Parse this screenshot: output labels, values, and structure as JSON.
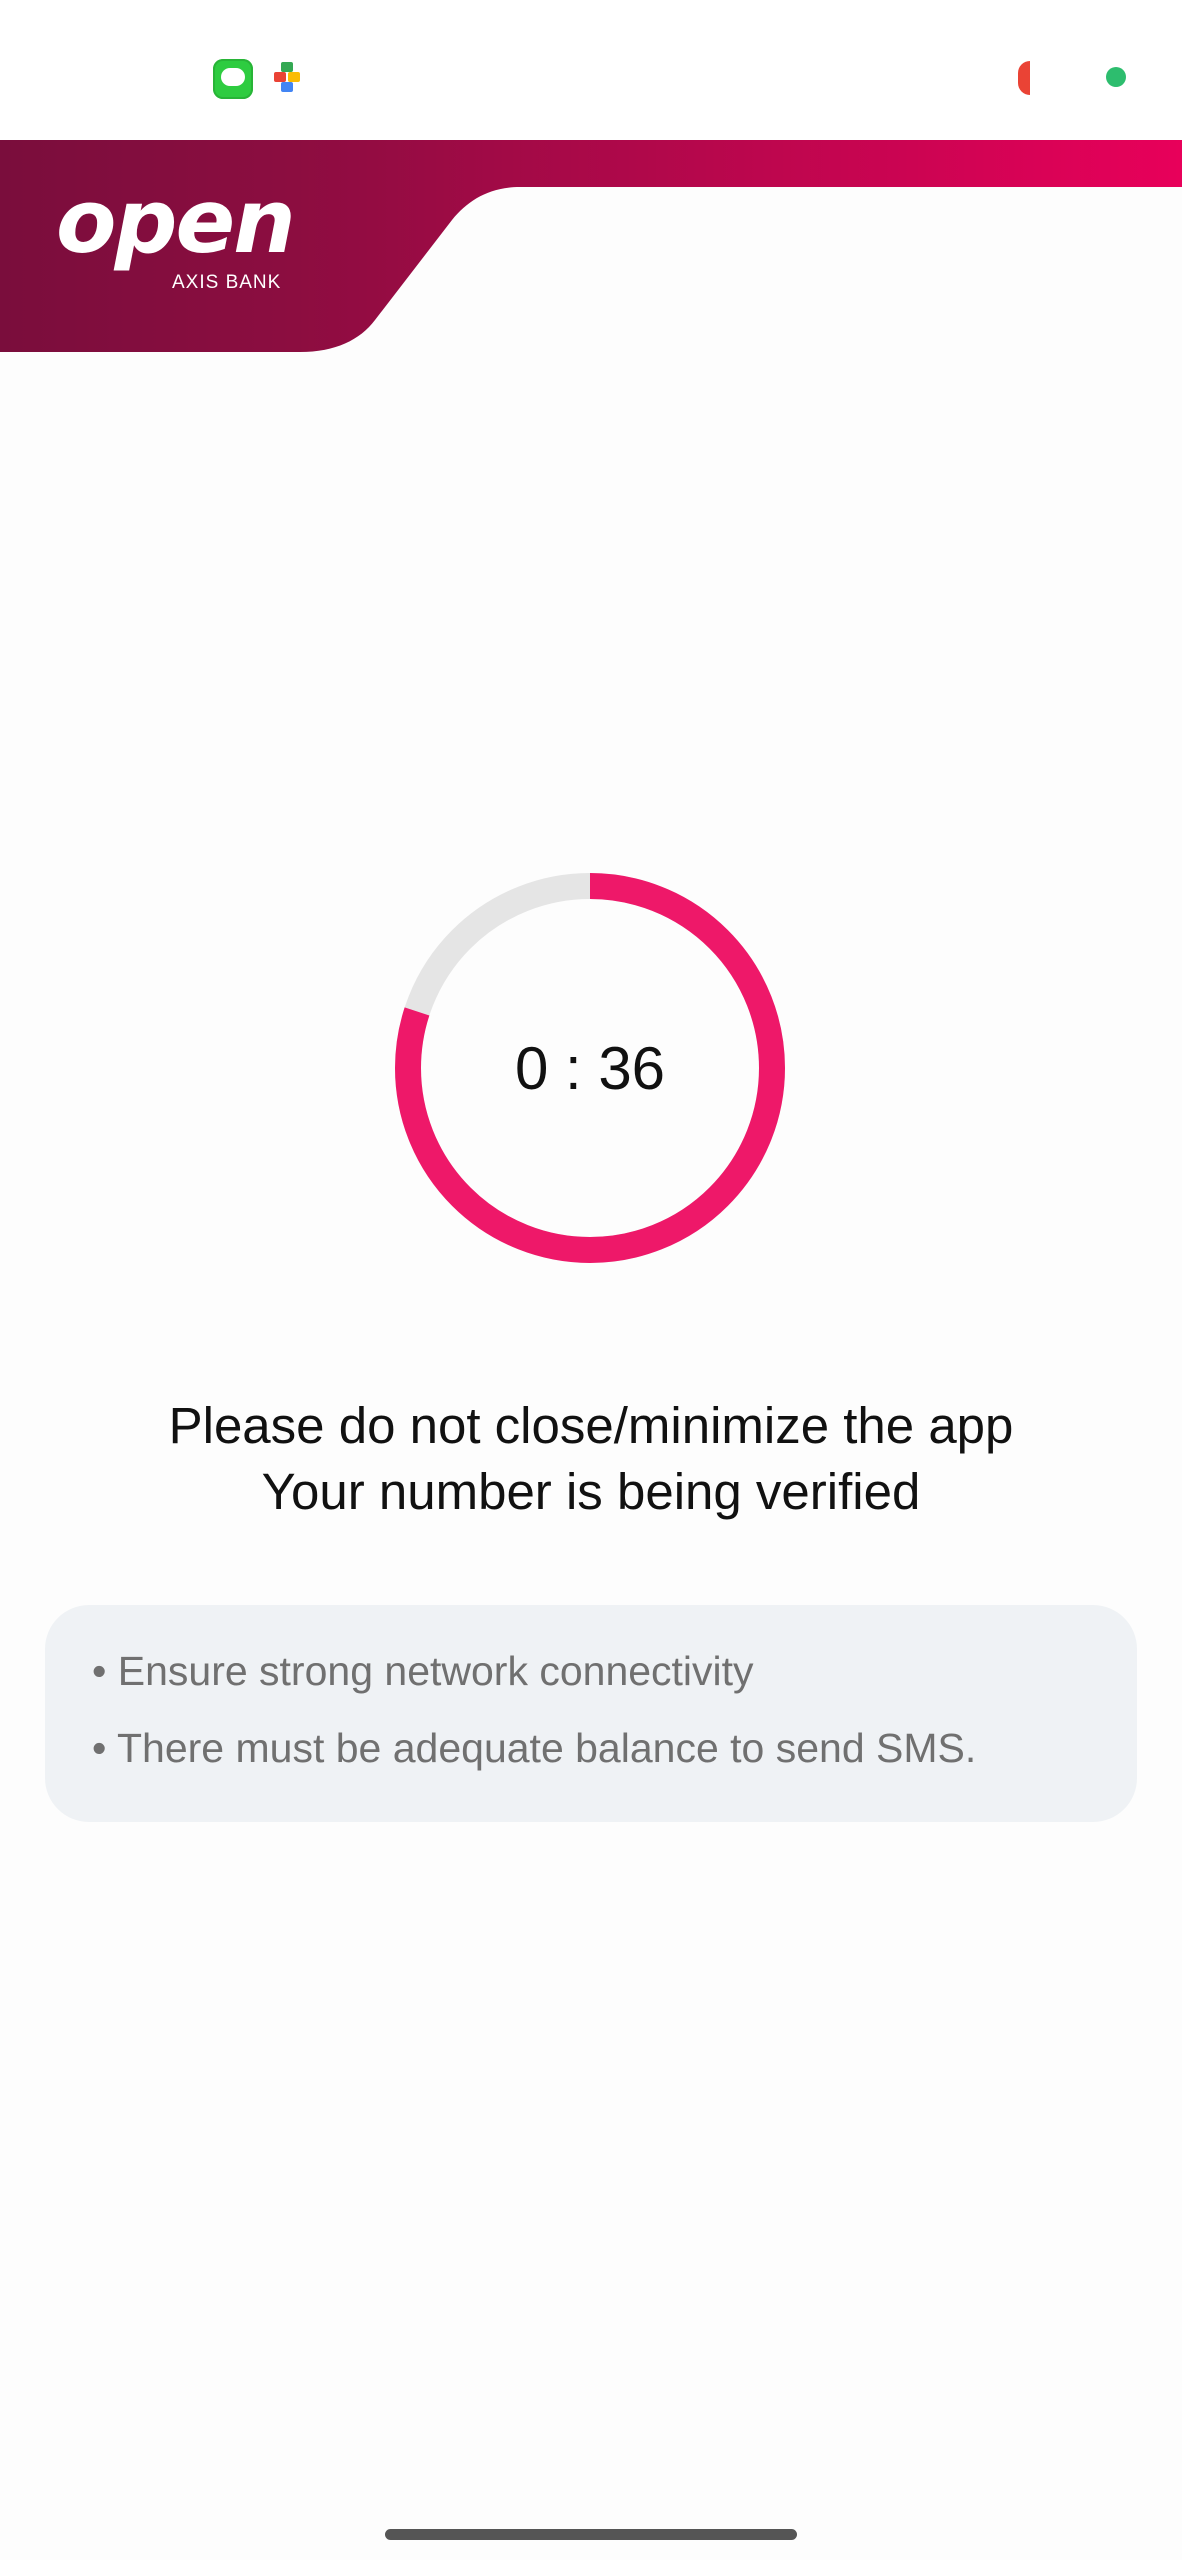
{
  "status_bar": {
    "icons": [
      "messages-icon",
      "puzzle-icon",
      "record-indicator",
      "green-dot"
    ]
  },
  "header": {
    "logo_word": "open",
    "logo_subtitle": "AXIS BANK",
    "colors": {
      "gradient_start": "#7a0d3c",
      "gradient_end": "#e8005a"
    }
  },
  "timer": {
    "display": "0 : 36",
    "progress_fraction": 0.8,
    "colors": {
      "progress": "#ee1869",
      "track": "#e5e5e5"
    }
  },
  "message": {
    "line1": "Please do not close/minimize the app",
    "line2": "Your number is being verified"
  },
  "tips": [
    "• Ensure strong network connectivity",
    "• There must be adequate balance to send SMS."
  ]
}
